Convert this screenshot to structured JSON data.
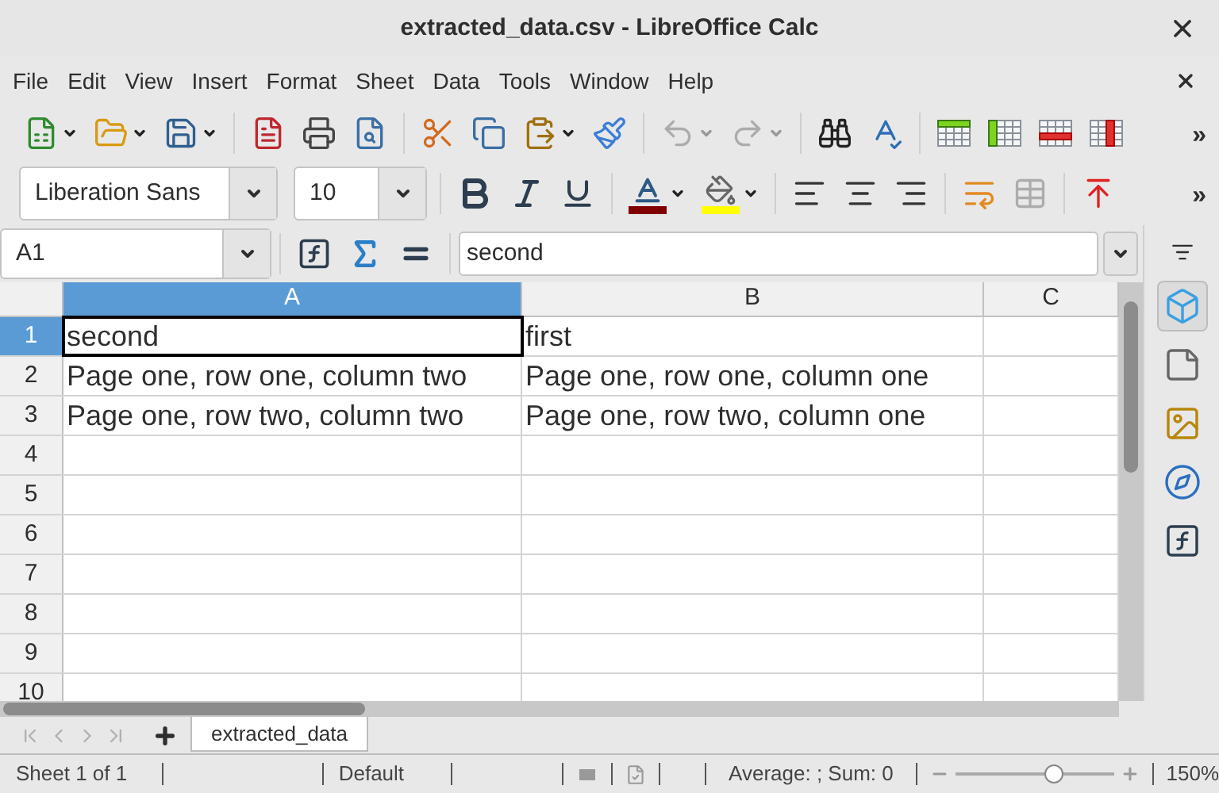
{
  "window": {
    "title": "extracted_data.csv - LibreOffice Calc"
  },
  "menu": [
    "File",
    "Edit",
    "View",
    "Insert",
    "Format",
    "Sheet",
    "Data",
    "Tools",
    "Window",
    "Help"
  ],
  "toolbar_standard": [
    [
      {
        "kind": "new",
        "disabled": false
      },
      {
        "kind": "open",
        "disabled": false
      },
      {
        "kind": "save",
        "disabled": false
      }
    ],
    [
      {
        "kind": "pdf",
        "disabled": false
      },
      {
        "kind": "print",
        "disabled": false
      },
      {
        "kind": "preview",
        "disabled": false
      }
    ],
    [
      {
        "kind": "cut",
        "disabled": false
      },
      {
        "kind": "copy",
        "disabled": false
      },
      {
        "kind": "paste",
        "disabled": false
      },
      {
        "kind": "brush",
        "disabled": false
      }
    ],
    [
      {
        "kind": "undo",
        "disabled": true
      },
      {
        "kind": "redo",
        "disabled": true
      }
    ],
    [
      {
        "kind": "find",
        "disabled": false
      },
      {
        "kind": "spell",
        "disabled": false
      }
    ],
    [
      {
        "kind": "row-head",
        "disabled": false
      },
      {
        "kind": "col-head",
        "disabled": false
      },
      {
        "kind": "row-ins",
        "disabled": false
      },
      {
        "kind": "col-ins",
        "disabled": false
      }
    ]
  ],
  "toolbar_standard_more": "»",
  "font_name": "Liberation Sans",
  "font_size": "10",
  "toolbar_format": [
    [
      {
        "kind": "bold",
        "disabled": false
      },
      {
        "kind": "italic",
        "disabled": false
      },
      {
        "kind": "underline",
        "disabled": false
      }
    ],
    [
      {
        "kind": "font-color",
        "disabled": false,
        "color": "#800000"
      },
      {
        "kind": "highlight",
        "disabled": false,
        "color": "#ffff00"
      }
    ],
    [
      {
        "kind": "align-left",
        "disabled": false
      },
      {
        "kind": "align-center",
        "disabled": false
      },
      {
        "kind": "align-right",
        "disabled": false
      }
    ],
    [
      {
        "kind": "wrap",
        "disabled": false
      },
      {
        "kind": "merge",
        "disabled": true
      }
    ],
    [
      {
        "kind": "align-top",
        "disabled": false
      }
    ]
  ],
  "toolbar_format_more": "»",
  "formula_bar": {
    "name_box": "A1",
    "formula": "second"
  },
  "columns": [
    {
      "label": "A",
      "selected": true
    },
    {
      "label": "B",
      "selected": false
    },
    {
      "label": "C",
      "selected": false
    }
  ],
  "rows": [
    {
      "header": "1",
      "selected": true,
      "cells": [
        "second",
        "first"
      ]
    },
    {
      "header": "2",
      "selected": false,
      "cells": [
        "Page one, row one, column two",
        "Page one, row one, column one"
      ]
    },
    {
      "header": "3",
      "selected": false,
      "cells": [
        "Page one, row two, column two",
        "Page one, row two, column one"
      ]
    },
    {
      "header": "4",
      "selected": false
    },
    {
      "header": "5",
      "selected": false
    },
    {
      "header": "6",
      "selected": false
    },
    {
      "header": "7",
      "selected": false
    },
    {
      "header": "8",
      "selected": false
    },
    {
      "header": "9",
      "selected": false
    },
    {
      "header": "10",
      "selected": false
    }
  ],
  "sidebar": [
    {
      "kind": "properties",
      "selected": true
    },
    {
      "kind": "styles",
      "selected": false
    },
    {
      "kind": "gallery",
      "selected": false
    },
    {
      "kind": "navigator",
      "selected": false
    },
    {
      "kind": "functions",
      "selected": false
    }
  ],
  "sheet_tabs": [
    {
      "label": "extracted_data",
      "selected": true
    }
  ],
  "status_bar": {
    "sheet": "Sheet 1 of 1",
    "page_style": "Default",
    "summary": "Average: ; Sum: 0",
    "zoom": "150%",
    "zoom_slider": {
      "level": 0.62
    }
  }
}
